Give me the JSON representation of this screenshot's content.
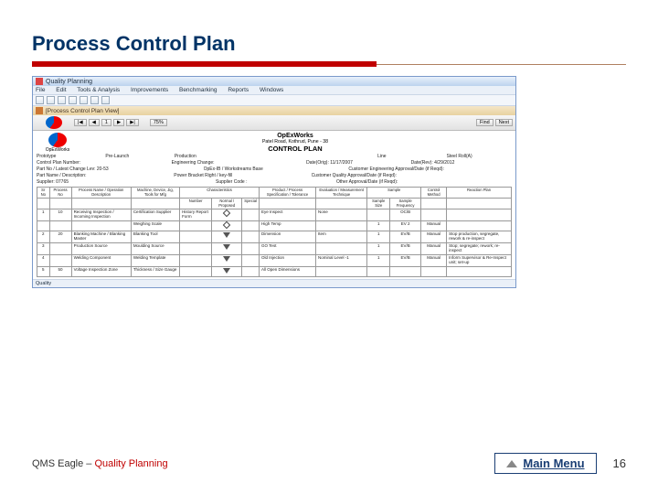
{
  "slide": {
    "title": "Process Control Plan",
    "footer_left_a": "QMS Eagle – ",
    "footer_left_b": "Quality Planning",
    "main_menu_label": "Main Menu",
    "page_number": "16"
  },
  "window": {
    "titlebar": "Quality Planning",
    "menu": [
      "File",
      "Edit",
      "Tools & Analysis",
      "Improvements",
      "Benchmarking",
      "Reports",
      "Windows"
    ],
    "subdoc": "[Process Control Plan View]",
    "nav": {
      "first": "|◀",
      "prev": "◀",
      "page": "1",
      "next": "▶",
      "last": "▶|",
      "zoom": "75%",
      "find": "Find",
      "next_find": "Next"
    },
    "logo_caption": "OpExWorks",
    "header_brand": "OpExWorks",
    "header_sub": "Patel Road, Kothrud, Pune - 38",
    "header_title": "CONTROL PLAN",
    "meta": {
      "r1": [
        "Prototype",
        "Pre-Launch",
        "Production",
        "",
        "",
        "Line",
        "Steel Roll(A)"
      ],
      "r1b": [
        "Control Plan Number:",
        "",
        "Engineering Change:",
        "",
        "Date(Orig): 11/17/2007",
        "Date(Rev): 4/29/2012"
      ],
      "r2": [
        "Part No / Latest Change Lev: 20-53",
        "",
        "OpEx-IB / Workstreams Base",
        "",
        "Customer Engineering Approval/Date (if Reqd):"
      ],
      "r3": [
        "Part Name / Description:",
        "Power Bracket Right / key-fill",
        "",
        "",
        "Customer Quality Approval/Date (if Reqd):"
      ],
      "r4": [
        "Supplier:   07765",
        "",
        "Supplier Code :",
        "",
        "Other Approval/Date (if Reqd):"
      ]
    },
    "columns": [
      "Sr No",
      "Process No",
      "Process Name / Operation Description",
      "Machine, Device, Jig, Tools for Mfg",
      "Characteristic No",
      "Special Characteristics Class",
      "Product / Process Specification / Tolerance",
      "Evaluation / Measurement Technique",
      "Sample Size",
      "Sample Frequency",
      "Control Method",
      "Reaction Plan"
    ],
    "subheader": [
      "",
      "",
      "",
      "",
      "Number",
      "Normal / Proposed",
      "Special",
      "",
      "",
      "",
      "",
      ""
    ],
    "rows": [
      {
        "sr": "1",
        "pno": "10",
        "proc": "Receiving Inspection / Incoming Inspection",
        "mach": "Certification Supplier",
        "cno": "History Report Form",
        "spec_sym": "diamond",
        "spec": "Eye Inspect",
        "eval": "None",
        "size": "",
        "freq": "OC/B",
        "ctrl": "",
        "rx": ""
      },
      {
        "sr": "",
        "pno": "",
        "proc": "",
        "mach": "Weighing Scale",
        "cno": "",
        "spec_sym": "diamond",
        "spec": "High Temp",
        "eval": "",
        "size": "1",
        "freq": "EV 2",
        "ctrl": "Manual",
        "rx": ""
      },
      {
        "sr": "2",
        "pno": "20",
        "proc": "Blanking Machine / Blanking Master",
        "mach": "Blanking Tool",
        "cno": "",
        "spec_sym": "tri",
        "spec": "Dimension",
        "eval": "Item",
        "size": "1",
        "freq": "EV/B",
        "ctrl": "Manual",
        "rx": "Stop production, segregate, rework & re-inspect"
      },
      {
        "sr": "3",
        "pno": "",
        "proc": "Production Source",
        "mach": "Moulding Source",
        "cno": "",
        "spec_sym": "tri",
        "spec": "GO Test",
        "eval": "",
        "size": "1",
        "freq": "EV/B",
        "ctrl": "Manual",
        "rx": "Stop; segregate; rework; re-inspect"
      },
      {
        "sr": "4",
        "pno": "",
        "proc": "Welding Component",
        "mach": "Welding Template",
        "cno": "",
        "spec_sym": "tri",
        "spec": "Old Injection",
        "eval": "Nominal Level -1",
        "size": "1",
        "freq": "EV/B",
        "ctrl": "Manual",
        "rx": "Inform Supervisor & Re-Inspect unit; set-up"
      },
      {
        "sr": "5",
        "pno": "50",
        "proc": "Voltage Inspection Zone",
        "mach": "Thickness / Size Gauge",
        "cno": "",
        "spec_sym": "tri",
        "spec": "All Open Dimensions",
        "eval": "",
        "size": "",
        "freq": "",
        "ctrl": "",
        "rx": ""
      }
    ],
    "status": "Quality"
  }
}
